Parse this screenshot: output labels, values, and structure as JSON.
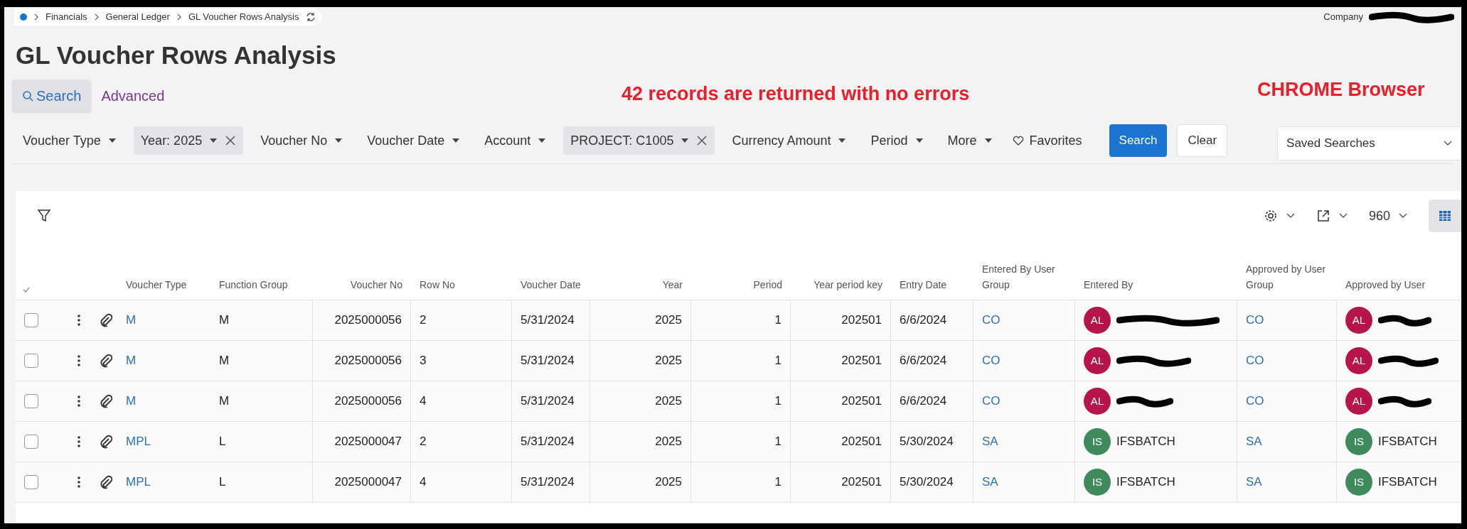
{
  "breadcrumb": [
    "Financials",
    "General Ledger",
    "GL Voucher Rows Analysis"
  ],
  "company": {
    "label": "Company",
    "value_redacted": true
  },
  "title": "GL Voucher Rows Analysis",
  "search_tabs": [
    {
      "label": "Search",
      "selected": true
    },
    {
      "label": "Advanced",
      "selected": false
    }
  ],
  "annotations": [
    {
      "text": "42 records are returned with no errors",
      "color": "#e8202a"
    },
    {
      "text": "CHROME Browser",
      "color": "#e8202a"
    }
  ],
  "filters": [
    {
      "label": "Voucher Type",
      "active": false
    },
    {
      "label": "Year: 2025",
      "active": true
    },
    {
      "label": "Voucher No",
      "active": false
    },
    {
      "label": "Voucher Date",
      "active": false
    },
    {
      "label": "Account",
      "active": false
    },
    {
      "label": "PROJECT: C1005",
      "active": true
    },
    {
      "label": "Currency Amount",
      "active": false
    },
    {
      "label": "Period",
      "active": false
    },
    {
      "label": "More",
      "active": false
    }
  ],
  "favorites": "Favorites",
  "search_button": "Search",
  "clear_button": "Clear",
  "saved_searches": {
    "placeholder": "Saved Searches"
  },
  "toolbar": {
    "page_size": "960"
  },
  "table": {
    "columns": [
      "Voucher Type",
      "Function Group",
      "Voucher No",
      "Row No",
      "Voucher Date",
      "Year",
      "Period",
      "Year period key",
      "Entry Date",
      "Entered By User Group",
      "Entered By",
      "Approved by User Group",
      "Approved by User"
    ],
    "rows": [
      {
        "checked": false,
        "voucher_type": "M",
        "function_group": "M",
        "voucher_no": "2025000056",
        "row_no": "2",
        "voucher_date": "5/31/2024",
        "year": "2025",
        "period": "1",
        "year_period_key": "202501",
        "entry_date": "6/6/2024",
        "entered_group": "CO",
        "entered_by": {
          "initials": "AL",
          "color": "#b5154b",
          "redacted": true
        },
        "approved_group": "CO",
        "approved_by": {
          "initials": "AL",
          "color": "#b5154b",
          "redacted": true
        }
      },
      {
        "checked": false,
        "voucher_type": "M",
        "function_group": "M",
        "voucher_no": "2025000056",
        "row_no": "3",
        "voucher_date": "5/31/2024",
        "year": "2025",
        "period": "1",
        "year_period_key": "202501",
        "entry_date": "6/6/2024",
        "entered_group": "CO",
        "entered_by": {
          "initials": "AL",
          "color": "#b5154b",
          "redacted": true
        },
        "approved_group": "CO",
        "approved_by": {
          "initials": "AL",
          "color": "#b5154b",
          "redacted": true
        }
      },
      {
        "checked": false,
        "voucher_type": "M",
        "function_group": "M",
        "voucher_no": "2025000056",
        "row_no": "4",
        "voucher_date": "5/31/2024",
        "year": "2025",
        "period": "1",
        "year_period_key": "202501",
        "entry_date": "6/6/2024",
        "entered_group": "CO",
        "entered_by": {
          "initials": "AL",
          "color": "#b5154b",
          "redacted": true
        },
        "approved_group": "CO",
        "approved_by": {
          "initials": "AL",
          "color": "#b5154b",
          "redacted": true
        }
      },
      {
        "checked": false,
        "voucher_type": "MPL",
        "function_group": "L",
        "voucher_no": "2025000047",
        "row_no": "2",
        "voucher_date": "5/31/2024",
        "year": "2025",
        "period": "1",
        "year_period_key": "202501",
        "entry_date": "5/30/2024",
        "entered_group": "SA",
        "entered_by": {
          "initials": "IS",
          "color": "#3f8a5c",
          "name": "IFSBATCH"
        },
        "approved_group": "SA",
        "approved_by": {
          "initials": "IS",
          "color": "#3f8a5c",
          "name": "IFSBATCH"
        }
      },
      {
        "checked": false,
        "voucher_type": "MPL",
        "function_group": "L",
        "voucher_no": "2025000047",
        "row_no": "4",
        "voucher_date": "5/31/2024",
        "year": "2025",
        "period": "1",
        "year_period_key": "202501",
        "entry_date": "5/30/2024",
        "entered_group": "SA",
        "entered_by": {
          "initials": "IS",
          "color": "#3f8a5c",
          "name": "IFSBATCH"
        },
        "approved_group": "SA",
        "approved_by": {
          "initials": "IS",
          "color": "#3f8a5c",
          "name": "IFSBATCH"
        }
      }
    ]
  }
}
